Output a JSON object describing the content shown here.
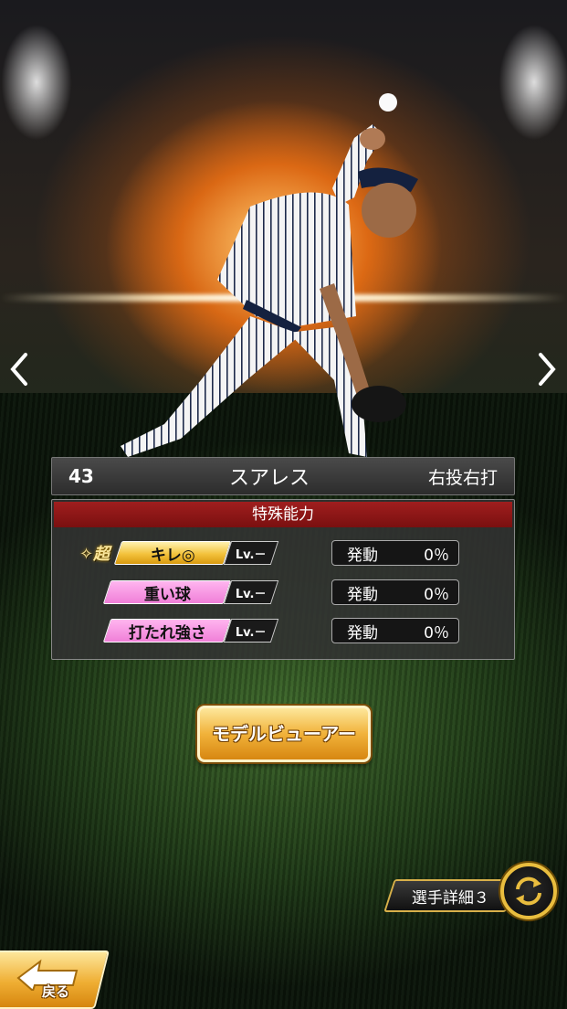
{
  "player": {
    "number": "43",
    "name": "スアレス",
    "handedness": "右投右打"
  },
  "abilities": {
    "header": "特殊能力",
    "items": [
      {
        "name": "キレ◎",
        "super_label": "✧超",
        "level": "Lv.－",
        "trigger_label": "発動",
        "trigger_value": "0％",
        "color": "gold"
      },
      {
        "name": "重い球",
        "level": "Lv.－",
        "trigger_label": "発動",
        "trigger_value": "0％",
        "color": "pink"
      },
      {
        "name": "打たれ強さ",
        "level": "Lv.－",
        "trigger_label": "発動",
        "trigger_value": "0％",
        "color": "pink"
      }
    ]
  },
  "buttons": {
    "model_viewer": "モデルビューアー",
    "detail_tab": "選手詳細３",
    "back": "戻る"
  },
  "icons": {
    "prev": "chevron-left-icon",
    "next": "chevron-right-icon",
    "swap": "swap-icon",
    "back": "back-arrow-icon"
  },
  "colors": {
    "header_red": "#8f1717",
    "gold": "#f3c23c",
    "pink": "#f07fd8"
  }
}
